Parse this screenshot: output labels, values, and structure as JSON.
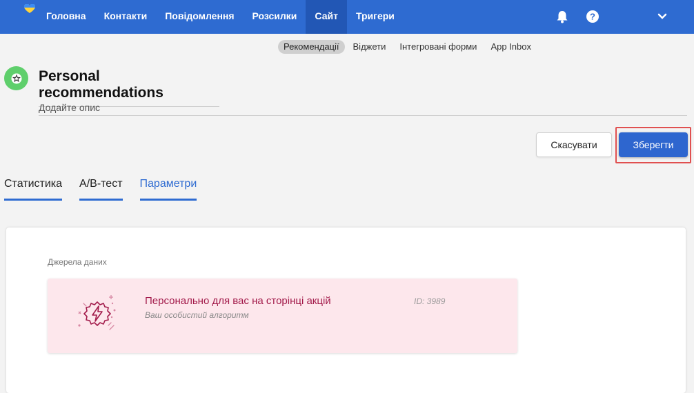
{
  "nav": {
    "items": [
      "Головна",
      "Контакти",
      "Повідомлення",
      "Розсилки",
      "Сайт",
      "Тригери"
    ],
    "active_index": 4
  },
  "icons": {
    "logo": "heart-logo-icon",
    "bell": "bell-icon",
    "help": "help-icon",
    "chevron": "chevron-down-icon",
    "star": "star-icon",
    "source": "lightning-badge-icon"
  },
  "subnav": {
    "items": [
      "Рекомендації",
      "Віджети",
      "Інтегровані форми",
      "App Inbox"
    ],
    "active_index": 0
  },
  "page": {
    "title": "Personal recommendations",
    "description_placeholder": "Додайте опис"
  },
  "actions": {
    "cancel": "Скасувати",
    "save": "Зберегти"
  },
  "tabs": {
    "items": [
      "Статистика",
      "A/B-тест",
      "Параметри"
    ],
    "active_index": 2
  },
  "data_sources": {
    "label": "Джерела даних",
    "items": [
      {
        "title": "Персонально для вас на сторінці акцій",
        "subtitle": "Ваш особистий алгоритм",
        "id": "ID: 3989"
      }
    ]
  },
  "colors": {
    "nav_bg": "#2e6bd1",
    "nav_active": "#2257b5",
    "accent": "#2e6bd1",
    "save_bg": "#2e66cf",
    "source_bg": "#fde7ec",
    "source_title": "#a21a4a",
    "rec_icon_bg": "#5fcf6c",
    "highlight": "#e05050"
  }
}
